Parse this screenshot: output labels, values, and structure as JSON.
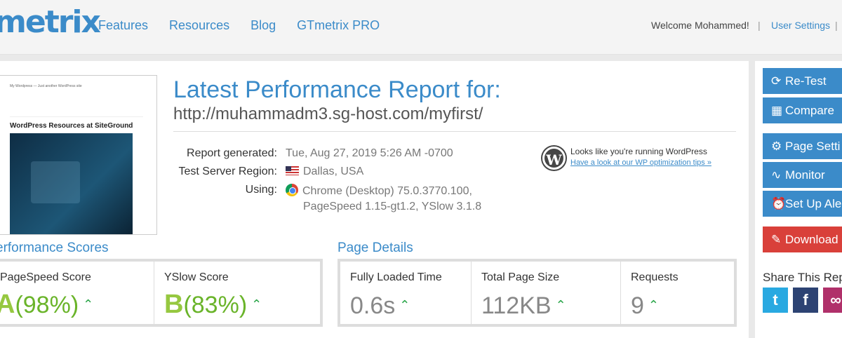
{
  "header": {
    "logo": "metrix",
    "nav": [
      "Features",
      "Resources",
      "Blog",
      "GTmetrix PRO"
    ],
    "welcome": "Welcome Mohammed!",
    "user_settings": "User Settings"
  },
  "thumbnail": {
    "site_name": "My Wordpress  —  Just another WordPress site",
    "headline": "WordPress Resources at SiteGround"
  },
  "report": {
    "title": "Latest Performance Report for:",
    "url": "http://muhammadm3.sg-host.com/myfirst/",
    "generated_label": "Report generated:",
    "generated_value": "Tue, Aug 27, 2019 5:26 AM -0700",
    "region_label": "Test Server Region:",
    "region_value": "Dallas, USA",
    "using_label": "Using:",
    "using_value_1": "Chrome (Desktop) 75.0.3770.100,",
    "using_value_2": "PageSpeed 1.15-gt1.2, YSlow 3.1.8"
  },
  "wordpress": {
    "line1": "Looks like you're running WordPress",
    "line2": "Have a look at our WP optimization tips »"
  },
  "scores": {
    "heading": "erformance Scores",
    "pagespeed_label": "PageSpeed Score",
    "pagespeed_grade": "A",
    "pagespeed_pct": "(98%)",
    "yslow_label": "YSlow Score",
    "yslow_grade": "B",
    "yslow_pct": "(83%)"
  },
  "details": {
    "heading": "Page Details",
    "loaded_label": "Fully Loaded Time",
    "loaded_value": "0.6s",
    "size_label": "Total Page Size",
    "size_value": "112KB",
    "requests_label": "Requests",
    "requests_value": "9"
  },
  "sidebar": {
    "retest": "Re-Test",
    "compare": "Compare",
    "page_settings": "Page Setti",
    "monitor": "Monitor",
    "alerts": "Set Up Ale",
    "download": "Download",
    "share": "Share This Repo"
  },
  "colors": {
    "accent": "#3b8bc9",
    "grade": "#96c840",
    "download": "#d9403a"
  }
}
